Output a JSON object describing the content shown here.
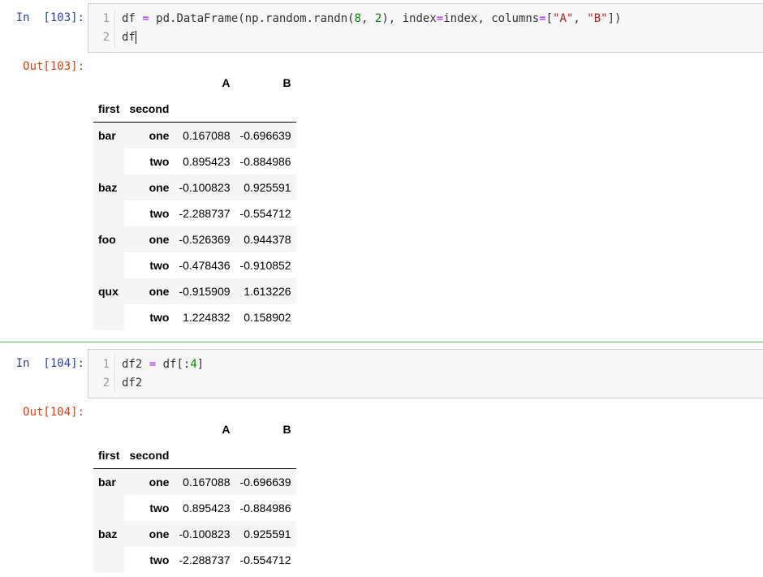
{
  "cells": [
    {
      "in_prompt": "In  [103]:",
      "out_prompt": "Out[103]:",
      "code": {
        "line_numbers": [
          "1",
          "2"
        ],
        "line1": {
          "t1": "df ",
          "t2": "=",
          "t3": " pd.DataFrame(np.random.randn(",
          "t4": "8",
          "t5": ", ",
          "t6": "2",
          "t7": "), index",
          "t8": "=",
          "t9": "index, columns",
          "t10": "=",
          "t11": "[",
          "t12": "\"A\"",
          "t13": ", ",
          "t14": "\"B\"",
          "t15": "])"
        },
        "line2": "df"
      },
      "table": {
        "columns": [
          "A",
          "B"
        ],
        "index_names": [
          "first",
          "second"
        ],
        "rows": [
          {
            "first": "bar",
            "second": "one",
            "A": "0.167088",
            "B": "-0.696639"
          },
          {
            "first": "",
            "second": "two",
            "A": "0.895423",
            "B": "-0.884986"
          },
          {
            "first": "baz",
            "second": "one",
            "A": "-0.100823",
            "B": "0.925591"
          },
          {
            "first": "",
            "second": "two",
            "A": "-2.288737",
            "B": "-0.554712"
          },
          {
            "first": "foo",
            "second": "one",
            "A": "-0.526369",
            "B": "0.944378"
          },
          {
            "first": "",
            "second": "two",
            "A": "-0.478436",
            "B": "-0.910852"
          },
          {
            "first": "qux",
            "second": "one",
            "A": "-0.915909",
            "B": "1.613226"
          },
          {
            "first": "",
            "second": "two",
            "A": "1.224832",
            "B": "0.158902"
          }
        ]
      }
    },
    {
      "in_prompt": "In  [104]:",
      "out_prompt": "Out[104]:",
      "code": {
        "line_numbers": [
          "1",
          "2"
        ],
        "line1": {
          "t1": "df2 ",
          "t2": "=",
          "t3": " df[:",
          "t4": "4",
          "t5": "]"
        },
        "line2": "df2"
      },
      "table": {
        "columns": [
          "A",
          "B"
        ],
        "index_names": [
          "first",
          "second"
        ],
        "rows": [
          {
            "first": "bar",
            "second": "one",
            "A": "0.167088",
            "B": "-0.696639"
          },
          {
            "first": "",
            "second": "two",
            "A": "0.895423",
            "B": "-0.884986"
          },
          {
            "first": "baz",
            "second": "one",
            "A": "-0.100823",
            "B": "0.925591"
          },
          {
            "first": "",
            "second": "two",
            "A": "-2.288737",
            "B": "-0.554712"
          }
        ]
      }
    }
  ],
  "colors": {
    "in_prompt": "#303f9f",
    "out_prompt": "#d84315",
    "operator": "#aa22ff",
    "number": "#008800",
    "string": "#ba2121",
    "cell_separator": "#66bb6a"
  }
}
